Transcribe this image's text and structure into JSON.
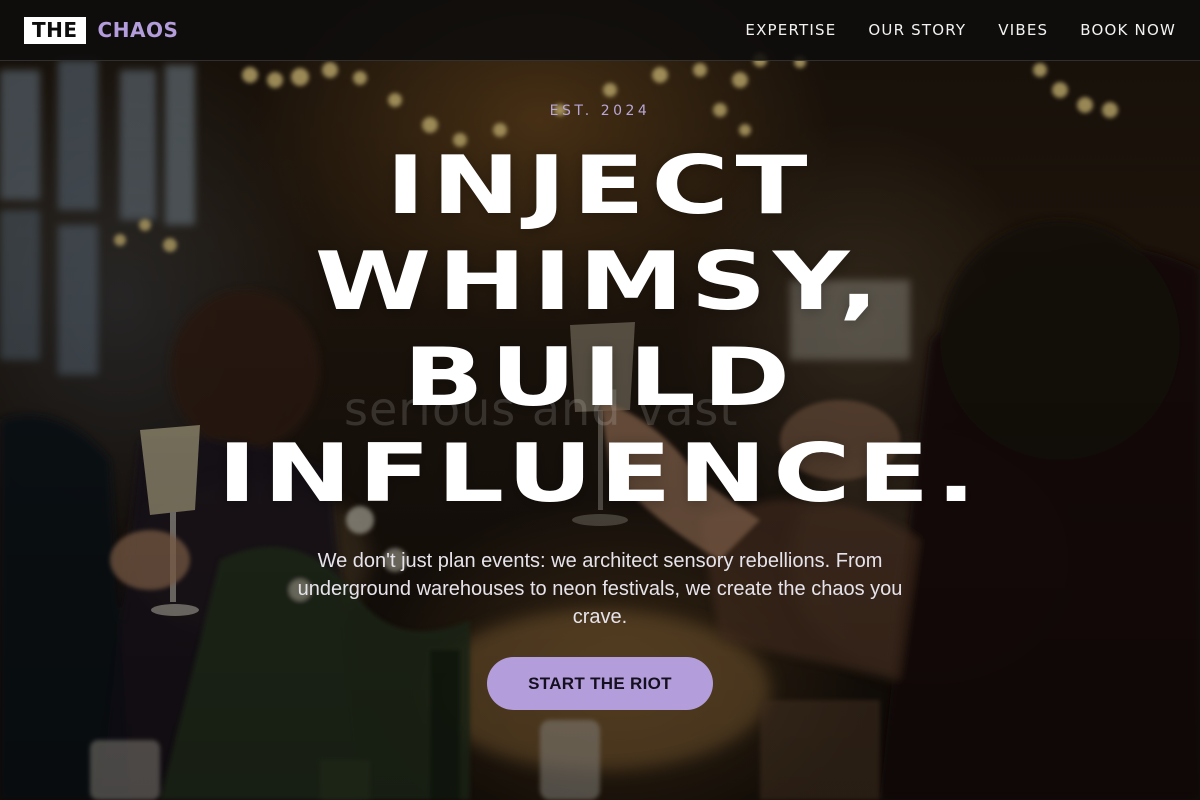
{
  "brand": {
    "logo_box": "THE",
    "logo_word": "CHAOS"
  },
  "nav": {
    "items": [
      {
        "label": "EXPERTISE"
      },
      {
        "label": "OUR STORY"
      },
      {
        "label": "VIBES"
      },
      {
        "label": "BOOK NOW"
      }
    ]
  },
  "hero": {
    "eyebrow": "EST. 2024",
    "headline_lines": [
      "INJECT",
      "WHIMSY,",
      "BUILD",
      "INFLUENCE."
    ],
    "ghost_text": "serious and vast",
    "tagline": "We don't just plan events: we architect sensory rebellions. From underground warehouses to neon festivals, we create the chaos you crave.",
    "cta_label": "START THE RIOT"
  },
  "colors": {
    "accent": "#b39ddb",
    "header_bg": "#0e0c0c",
    "text": "#ffffff"
  }
}
